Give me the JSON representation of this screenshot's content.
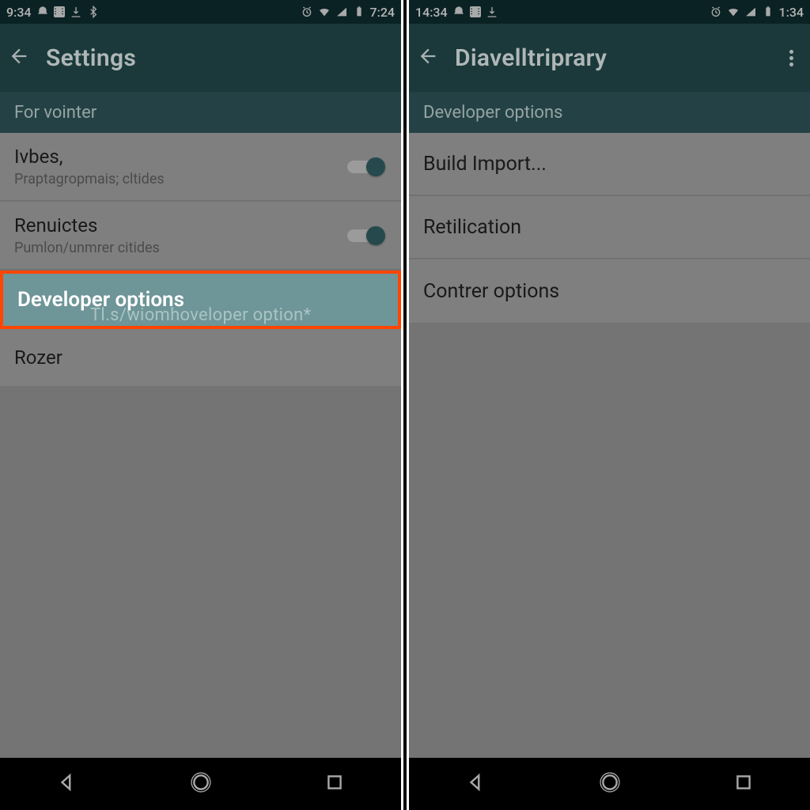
{
  "left": {
    "status": {
      "time_left": "9:34",
      "time_right": "7:24"
    },
    "appbar": {
      "title": "Settings"
    },
    "subheader": "For vointer",
    "rows": {
      "r1": {
        "primary": "Ivbes,",
        "secondary": "Praptagropmais; cltides"
      },
      "r2": {
        "primary": "Renuictes",
        "secondary": "Pumlon/unmrer citides"
      },
      "dev": {
        "primary": "Developer options",
        "ghost": "Tl.s/wiomhoveloper option*"
      },
      "r4": {
        "primary": "Rozer"
      }
    }
  },
  "right": {
    "status": {
      "time_left": "14:34",
      "time_right": "1:34"
    },
    "appbar": {
      "title": "Diavelltriprary"
    },
    "subheader": "Developer options",
    "rows": {
      "r1": {
        "primary": "Build Import..."
      },
      "r2": {
        "primary": "Retilication"
      },
      "r3": {
        "primary": "Contrer options"
      }
    }
  }
}
